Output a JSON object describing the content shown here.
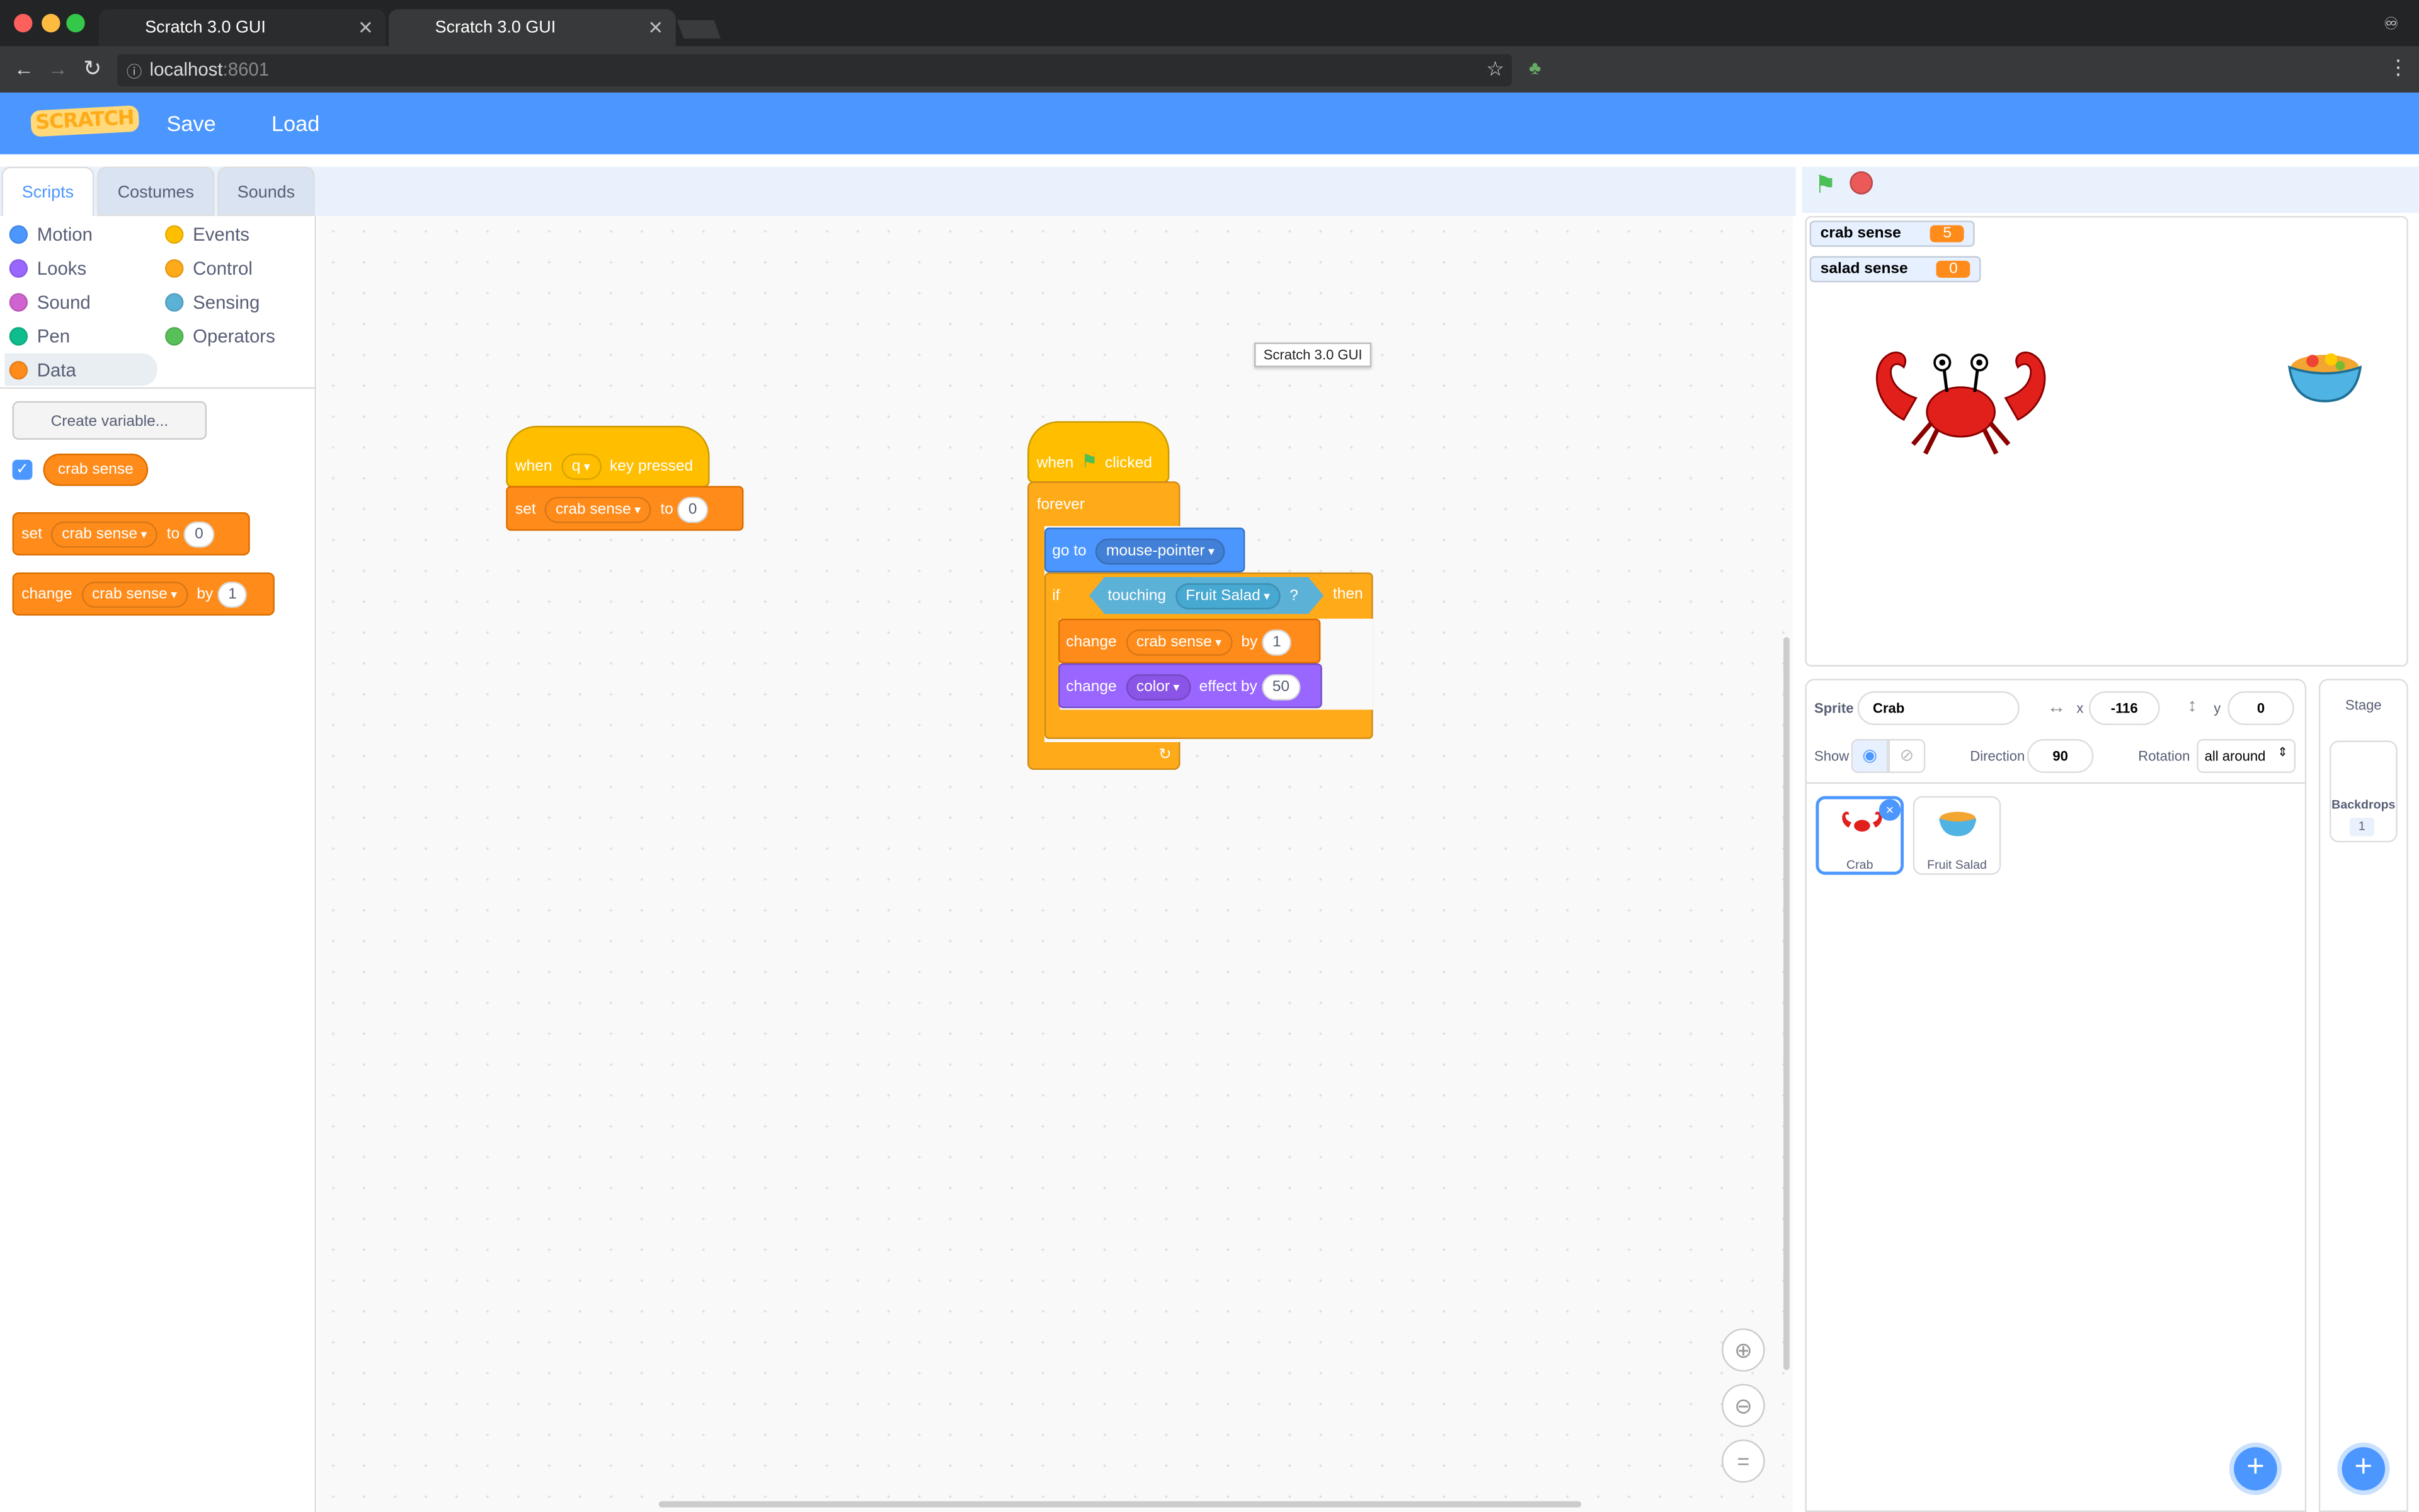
{
  "browser": {
    "tabs": [
      {
        "title": "Scratch 3.0 GUI"
      },
      {
        "title": "Scratch 3.0 GUI"
      }
    ],
    "url_host": "localhost",
    "url_port": ":8601"
  },
  "menubar": {
    "logo": "SCRATCH",
    "save": "Save",
    "load": "Load"
  },
  "editor_tabs": [
    "Scripts",
    "Costumes",
    "Sounds"
  ],
  "categories": {
    "left": [
      {
        "label": "Motion",
        "color": "#4c97ff"
      },
      {
        "label": "Looks",
        "color": "#9966ff"
      },
      {
        "label": "Sound",
        "color": "#cf63cf"
      },
      {
        "label": "Pen",
        "color": "#0fbd8c"
      },
      {
        "label": "Data",
        "color": "#ff8c1a"
      }
    ],
    "right": [
      {
        "label": "Events",
        "color": "#ffbf00"
      },
      {
        "label": "Control",
        "color": "#ffab19"
      },
      {
        "label": "Sensing",
        "color": "#5cb1d6"
      },
      {
        "label": "Operators",
        "color": "#59c059"
      }
    ]
  },
  "palette": {
    "create_variable": "Create variable...",
    "variable": "crab sense",
    "set_block": {
      "w1": "set",
      "var": "crab sense",
      "w2": "to",
      "val": "0"
    },
    "change_block": {
      "w1": "change",
      "var": "crab sense",
      "w2": "by",
      "val": "1"
    }
  },
  "script1": {
    "when": "when",
    "key": "q",
    "pressed": "key pressed",
    "set": "set",
    "var": "crab sense",
    "to": "to",
    "val": "0"
  },
  "script2": {
    "when": "when",
    "clicked": "clicked",
    "forever": "forever",
    "goto": "go to",
    "target": "mouse-pointer",
    "if": "if",
    "touching": "touching",
    "sprite": "Fruit Salad",
    "q": "?",
    "then": "then",
    "change": "change",
    "var": "crab sense",
    "by": "by",
    "by_val": "1",
    "change2": "change",
    "effect": "color",
    "effect_by": "effect by",
    "effect_val": "50"
  },
  "tooltip": "Scratch 3.0 GUI",
  "monitors": [
    {
      "label": "crab sense",
      "value": "5"
    },
    {
      "label": "salad sense",
      "value": "0"
    }
  ],
  "sprite_info": {
    "sprite_label": "Sprite",
    "sprite_name": "Crab",
    "x_label": "x",
    "x": "-116",
    "y_label": "y",
    "y": "0",
    "show_label": "Show",
    "direction_label": "Direction",
    "direction": "90",
    "rotation_label": "Rotation",
    "rotation": "all around"
  },
  "sprites": [
    {
      "name": "Crab"
    },
    {
      "name": "Fruit Salad"
    }
  ],
  "stage_panel": {
    "title": "Stage",
    "backdrops_label": "Backdrops",
    "backdrops_count": "1"
  },
  "zoom": {
    "reset": "="
  }
}
